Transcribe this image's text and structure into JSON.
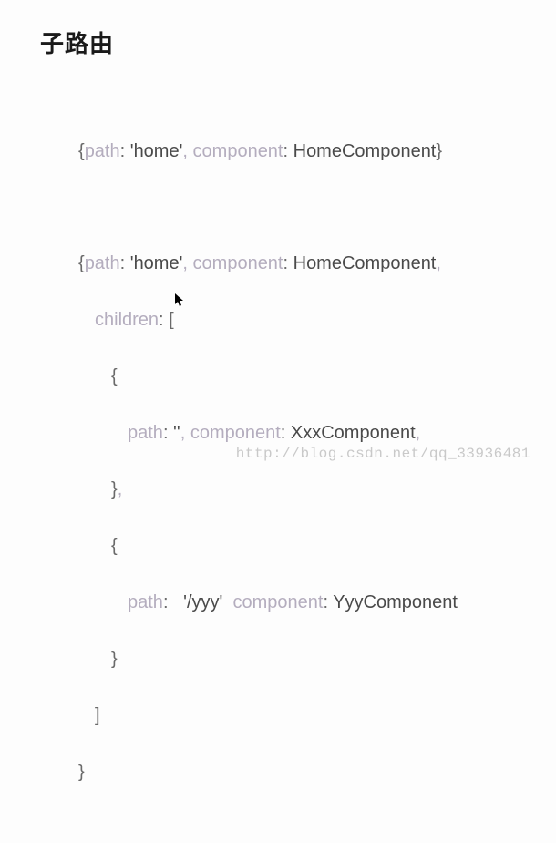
{
  "heading": "子路由",
  "code": {
    "block1": {
      "brace_open": "{",
      "path_key": "path",
      "path_val": " 'home'",
      "comp_key": ", component",
      "comp_val": " HomeComponent",
      "brace_close": "}"
    },
    "block2": {
      "l1_brace": "{",
      "l1_path_key": "path",
      "l1_path_val": " 'home'",
      "l1_comp_key": ", component",
      "l1_comp_val": " HomeComponent",
      "l1_comma": ",",
      "l2_children_key": "children",
      "l2_bracket": " [",
      "l3_brace": "{",
      "l4_path_key": "path",
      "l4_path_val": " ''",
      "l4_comp_key": ", component",
      "l4_comp_val": " XxxComponent",
      "l4_comma": ",",
      "l5_brace_close": "}",
      "l5_comma": ",",
      "l6_brace": "{",
      "l7_path_key": "path",
      "l7_path_val": "   '/yyy'",
      "l7_comp_key": "  component",
      "l7_comp_val": " YyyComponent",
      "l8_brace_close": "}",
      "l9_bracket_close": "]",
      "l10_brace_close": "}"
    }
  },
  "watermark": "http://blog.csdn.net/qq_33936481"
}
